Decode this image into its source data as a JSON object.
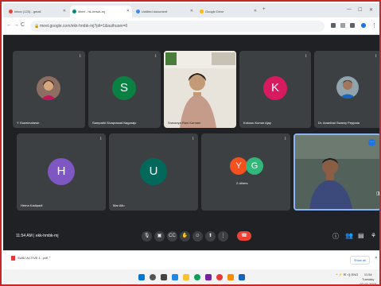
{
  "browser": {
    "tabs": [
      {
        "label": "Inbox (123) - gmail",
        "active": false
      },
      {
        "label": "Meet - hk-hmwk-mj",
        "active": true
      },
      {
        "label": "Untitled document",
        "active": false
      },
      {
        "label": "Google Drive",
        "active": false
      }
    ],
    "url": "meet.google.com/ekk-hmbk-mj?pli=1&authuser=0"
  },
  "meet": {
    "participants": [
      {
        "name": "Y Gowrimahesh",
        "initial": "",
        "color": "#5f6368",
        "type": "photo"
      },
      {
        "name": "Sampathi Sivaprasad Nagaraju",
        "initial": "S",
        "color": "#0b8043",
        "type": "initial"
      },
      {
        "name": "Sravanya Rani Karnam",
        "initial": "",
        "color": "",
        "type": "camera"
      },
      {
        "name": "Kokosu Kumar Ajay",
        "initial": "K",
        "color": "#d81b60",
        "type": "initial"
      },
      {
        "name": "Dr. Ananthal Swamy Peppala",
        "initial": "",
        "color": "#5f6368",
        "type": "photo"
      },
      {
        "name": "Hema Kadipadi",
        "initial": "H",
        "color": "#7e57c2",
        "type": "initial"
      },
      {
        "name": "Mar Allu",
        "initial": "U",
        "color": "#00695c",
        "type": "initial"
      }
    ],
    "others": {
      "label": "2 others",
      "initials": [
        "Y",
        "G"
      ],
      "colors": [
        "#f4511e",
        "#33b679"
      ]
    },
    "time": "11:54 AM",
    "meeting_code": "ekk-hmbk-mj"
  },
  "download": {
    "file": "SUBJ ACTIVE 1...pdf",
    "show_all": "Show all"
  },
  "taskbar": {
    "time": "11:54",
    "date": "Tuesday",
    "date2": "07-02-2023",
    "lang": "ENG"
  }
}
